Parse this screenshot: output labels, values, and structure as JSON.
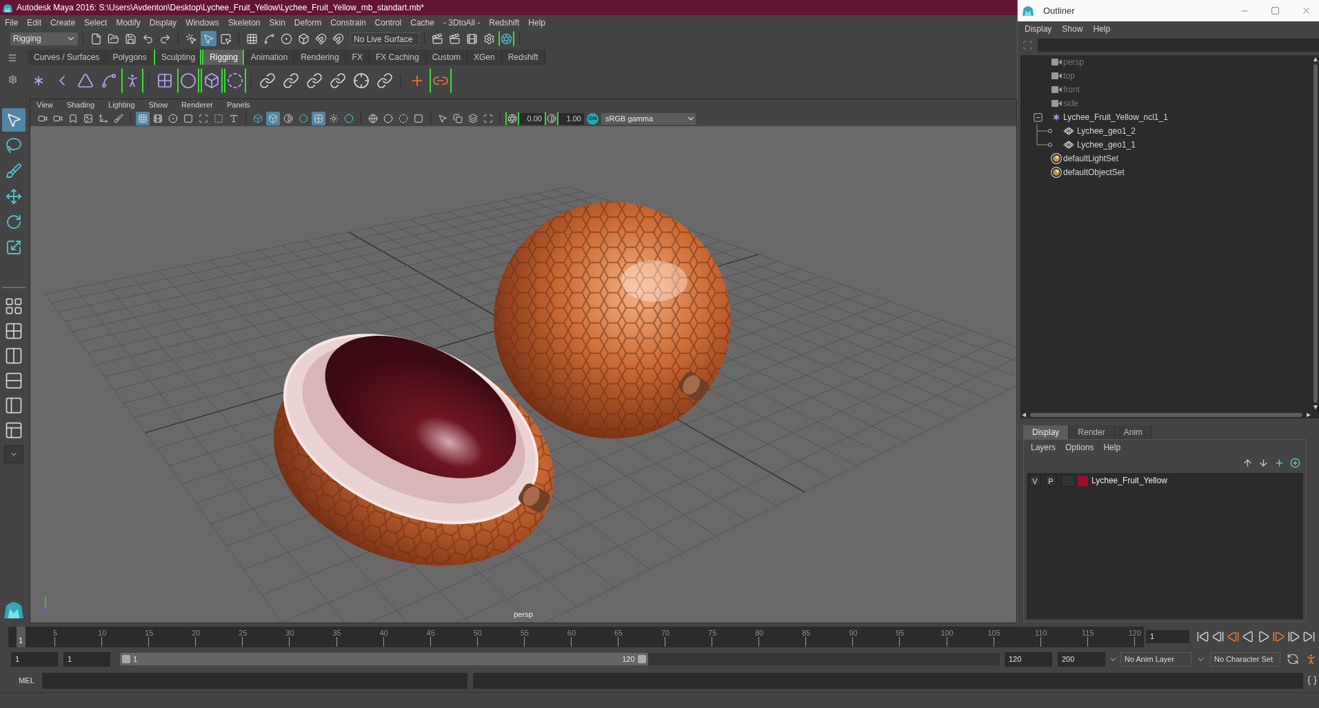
{
  "window": {
    "title": "Autodesk Maya 2016: S:\\Users\\Avdenton\\Desktop\\Lychee_Fruit_Yellow\\Lychee_Fruit_Yellow_mb_standart.mb*"
  },
  "menu_bar": [
    "File",
    "Edit",
    "Create",
    "Select",
    "Modify",
    "Display",
    "Windows",
    "Skeleton",
    "Skin",
    "Deform",
    "Constrain",
    "Control",
    "Cache",
    "- 3DtoAll -",
    "Redshift",
    "Help"
  ],
  "status_line": {
    "mode_menu": "Rigging",
    "live_surface": "No Live Surface",
    "buttons": [
      {
        "on": false,
        "highlighted": false
      },
      {
        "on": false,
        "highlighted": false
      },
      {
        "on": false,
        "highlighted": false
      },
      {
        "on": false,
        "highlighted": false
      },
      {
        "on": false,
        "highlighted": false
      },
      {
        "on": false,
        "highlighted": false
      },
      {
        "on": true,
        "highlighted": false
      },
      {
        "on": false,
        "highlighted": false
      },
      {
        "on": false,
        "highlighted": false
      },
      {
        "on": false,
        "highlighted": false
      },
      {
        "on": false,
        "highlighted": false
      },
      {
        "on": false,
        "highlighted": false
      },
      {
        "on": false,
        "highlighted": false
      },
      {
        "on": false,
        "highlighted": false
      },
      {
        "on": false,
        "highlighted": false
      },
      {
        "on": false,
        "highlighted": false
      },
      {
        "on": false,
        "highlighted": false
      },
      {
        "on": false,
        "highlighted": false
      },
      {
        "on": false,
        "highlighted": true
      }
    ]
  },
  "shelf": {
    "tabs": [
      {
        "label": "Curves / Surfaces",
        "selected": false,
        "highlighted": false
      },
      {
        "label": "Polygons",
        "selected": false,
        "highlighted": false
      },
      {
        "label": "Sculpting",
        "selected": false,
        "highlighted": true
      },
      {
        "label": "Rigging",
        "selected": true,
        "highlighted": true
      },
      {
        "label": "Animation",
        "selected": false,
        "highlighted": false
      },
      {
        "label": "Rendering",
        "selected": false,
        "highlighted": false
      },
      {
        "label": "FX",
        "selected": false,
        "highlighted": false
      },
      {
        "label": "FX Caching",
        "selected": false,
        "highlighted": false
      },
      {
        "label": "Custom",
        "selected": false,
        "highlighted": false
      },
      {
        "label": "XGen",
        "selected": false,
        "highlighted": false
      },
      {
        "label": "Redshift",
        "selected": false,
        "highlighted": false
      }
    ],
    "buttons": [
      {
        "highlighted": false
      },
      {
        "highlighted": false
      },
      {
        "highlighted": false
      },
      {
        "highlighted": false
      },
      {
        "highlighted": true
      },
      {
        "highlighted": false
      },
      {
        "highlighted": true
      },
      {
        "highlighted": true
      },
      {
        "highlighted": true
      },
      {
        "highlighted": false
      },
      {
        "highlighted": false
      },
      {
        "highlighted": false
      },
      {
        "highlighted": false
      },
      {
        "highlighted": false
      },
      {
        "highlighted": false
      },
      {
        "highlighted": false
      },
      {
        "highlighted": true
      }
    ]
  },
  "toolbox": {
    "tools": [
      {
        "selected": true
      },
      {
        "selected": false
      },
      {
        "selected": false
      },
      {
        "selected": false
      },
      {
        "selected": false
      },
      {
        "selected": false
      }
    ]
  },
  "viewport": {
    "menu": [
      "View",
      "Shading",
      "Lighting",
      "Show",
      "Renderer",
      "Panels"
    ],
    "buttons": [
      {
        "on": false
      },
      {
        "on": false
      },
      {
        "on": false
      },
      {
        "on": false
      },
      {
        "on": false
      },
      {
        "on": false
      },
      {
        "on": true
      },
      {
        "on": false
      },
      {
        "on": false
      },
      {
        "on": false
      },
      {
        "on": false
      },
      {
        "on": false
      },
      {
        "on": false
      },
      {
        "on": false
      },
      {
        "on": true
      },
      {
        "on": false
      },
      {
        "on": false
      },
      {
        "on": true
      },
      {
        "on": false
      },
      {
        "on": false
      },
      {
        "on": false
      },
      {
        "on": false
      },
      {
        "on": false
      },
      {
        "on": false
      },
      {
        "on": false
      },
      {
        "on": false
      },
      {
        "on": false
      },
      {
        "on": false
      }
    ],
    "exposure": {
      "value": "0.00",
      "highlighted": true
    },
    "gamma": {
      "value": "1.00",
      "highlighted": true
    },
    "color_management": {
      "label": "ON",
      "on": true
    },
    "color_space": "sRGB gamma",
    "camera_label": "persp"
  },
  "outliner": {
    "title": "Outliner",
    "menu": [
      "Display",
      "Show",
      "Help"
    ],
    "items": [
      {
        "label": "persp",
        "kind": "camera",
        "dimmed": true
      },
      {
        "label": "top",
        "kind": "camera",
        "dimmed": true
      },
      {
        "label": "front",
        "kind": "camera",
        "dimmed": true
      },
      {
        "label": "side",
        "kind": "camera",
        "dimmed": true
      },
      {
        "label": "Lychee_Fruit_Yellow_ncl1_1",
        "kind": "group",
        "dimmed": false,
        "expanded": true,
        "children": [
          {
            "label": "Lychee_geo1_2",
            "kind": "mesh",
            "dimmed": false
          },
          {
            "label": "Lychee_geo1_1",
            "kind": "mesh",
            "dimmed": false
          }
        ]
      },
      {
        "label": "defaultLightSet",
        "kind": "set",
        "dimmed": false
      },
      {
        "label": "defaultObjectSet",
        "kind": "set",
        "dimmed": false
      }
    ]
  },
  "layer_editor": {
    "tabs": [
      {
        "label": "Display",
        "selected": true
      },
      {
        "label": "Render",
        "selected": false
      },
      {
        "label": "Anim",
        "selected": false
      }
    ],
    "menu": [
      "Layers",
      "Options",
      "Help"
    ],
    "layers": [
      {
        "visibility": "V",
        "playback": "P",
        "color": "#9e0c2f",
        "name": "Lychee_Fruit_Yellow"
      }
    ]
  },
  "time_slider": {
    "current_frame_marker": "1",
    "level": 0.007,
    "ticks": [
      "5",
      "10",
      "15",
      "20",
      "25",
      "30",
      "35",
      "40",
      "45",
      "50",
      "55",
      "60",
      "65",
      "70",
      "75",
      "80",
      "85",
      "90",
      "95",
      "100",
      "105",
      "110",
      "115",
      "120"
    ],
    "current_frame": "1"
  },
  "range_slider": {
    "start": "1",
    "playback_start": "1",
    "range_start": "1",
    "range_end": "120",
    "level": 0.6,
    "playback_end": "120",
    "end": "200",
    "anim_layer": "No Anim Layer",
    "character_set": "No Character Set"
  },
  "command_line": {
    "language": "MEL"
  }
}
